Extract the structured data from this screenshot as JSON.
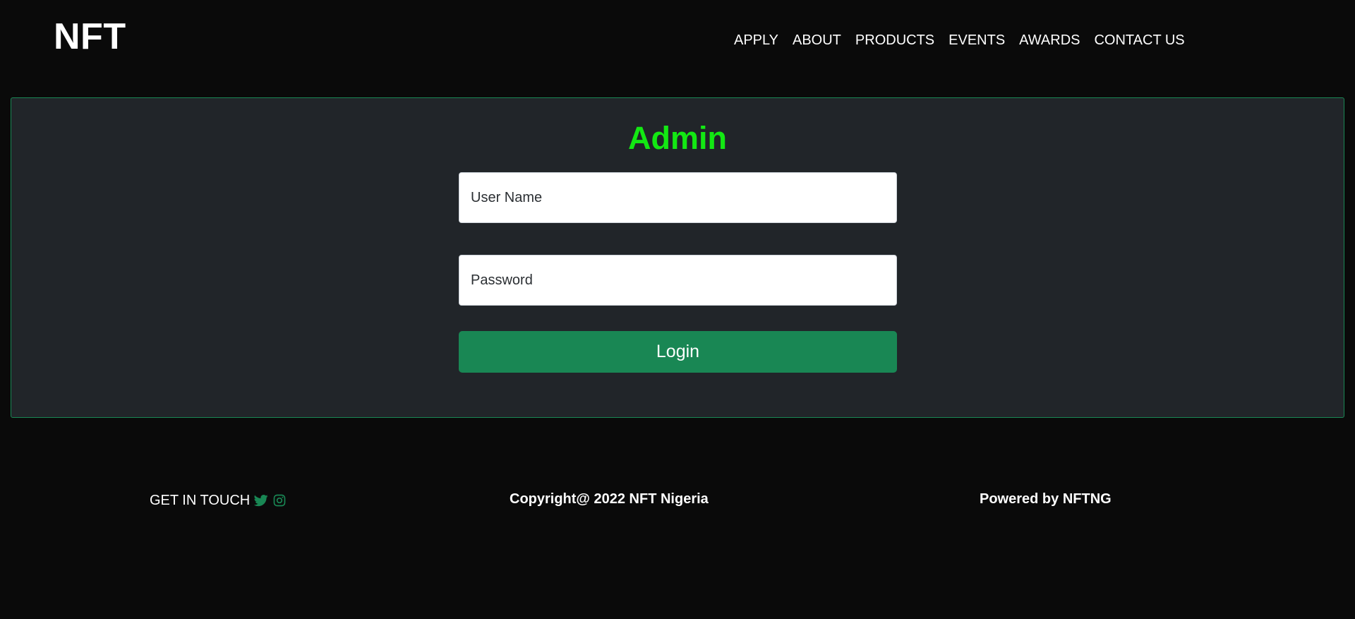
{
  "header": {
    "brand": "NFT",
    "nav": [
      "APPLY",
      "ABOUT",
      "PRODUCTS",
      "EVENTS",
      "AWARDS",
      "CONTACT US"
    ]
  },
  "login": {
    "title": "Admin",
    "username_placeholder": "User Name",
    "username_value": "",
    "password_placeholder": "Password",
    "password_value": "",
    "button_label": "Login"
  },
  "footer": {
    "get_in_touch": "GET IN TOUCH",
    "social_icons": [
      "twitter-icon",
      "instagram-icon"
    ],
    "copyright": "Copyright@ 2022 NFT Nigeria",
    "powered_by": "Powered by NFTNG"
  },
  "colors": {
    "background": "#0a0a0a",
    "panel": "#212529",
    "accent": "#198754",
    "title_green": "#13e813"
  }
}
